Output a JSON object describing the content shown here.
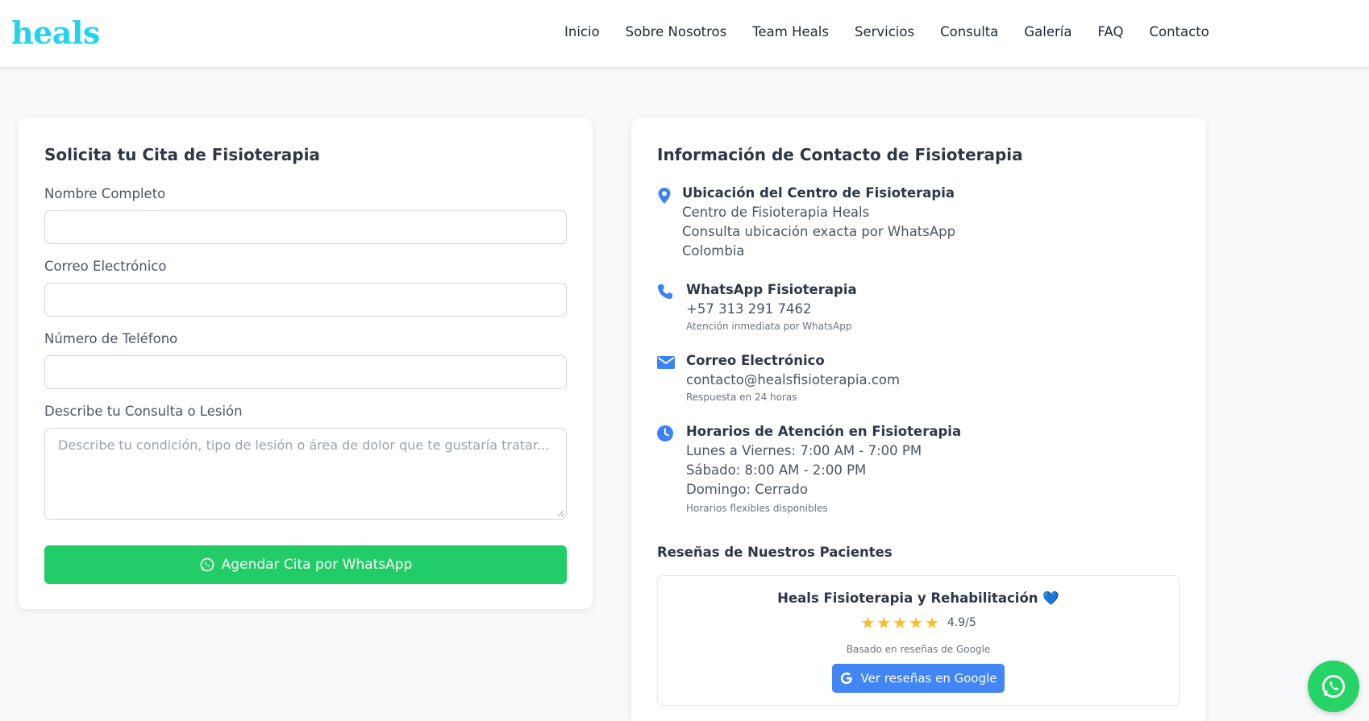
{
  "header": {
    "logo": "heals",
    "nav": [
      "Inicio",
      "Sobre Nosotros",
      "Team Heals",
      "Servicios",
      "Consulta",
      "Galería",
      "FAQ",
      "Contacto"
    ]
  },
  "form": {
    "title": "Solicita tu Cita de Fisioterapia",
    "name_label": "Nombre Completo",
    "email_label": "Correo Electrónico",
    "phone_label": "Número de Teléfono",
    "message_label": "Describe tu Consulta o Lesión",
    "message_placeholder": "Describe tu condición, tipo de lesión o área de dolor que te gustaría tratar...",
    "submit_label": "Agendar Cita por WhatsApp"
  },
  "contact": {
    "title": "Información de Contacto de Fisioterapia",
    "location": {
      "title": "Ubicación del Centro de Fisioterapia",
      "lines": [
        "Centro de Fisioterapia Heals",
        "Consulta ubicación exacta por WhatsApp",
        "Colombia"
      ]
    },
    "whatsapp": {
      "title": "WhatsApp Fisioterapia",
      "phone": "+57 313 291 7462",
      "note": "Atención inmediata por WhatsApp"
    },
    "email": {
      "title": "Correo Electrónico",
      "address": "contacto@healsfisioterapia.com",
      "note": "Respuesta en 24 horas"
    },
    "hours": {
      "title": "Horarios de Atención en Fisioterapia",
      "lines": [
        "Lunes a Viernes: 7:00 AM - 7:00 PM",
        "Sábado: 8:00 AM - 2:00 PM",
        "Domingo: Cerrado"
      ],
      "note": "Horarios flexibles disponibles"
    }
  },
  "reviews": {
    "title": "Reseñas de Nuestros Pacientes",
    "business_name": "Heals Fisioterapia y Rehabilitación",
    "heart": "💙",
    "rating": "4.9/5",
    "stars": 5,
    "based_on": "Basado en reseñas de Google",
    "button_label": "Ver reseñas en Google"
  },
  "colors": {
    "brand": "#22d3ee",
    "whatsapp": "#22cc66",
    "icon_blue": "#3b82f6",
    "google_blue": "#4285f4",
    "star": "#fbbf24"
  }
}
